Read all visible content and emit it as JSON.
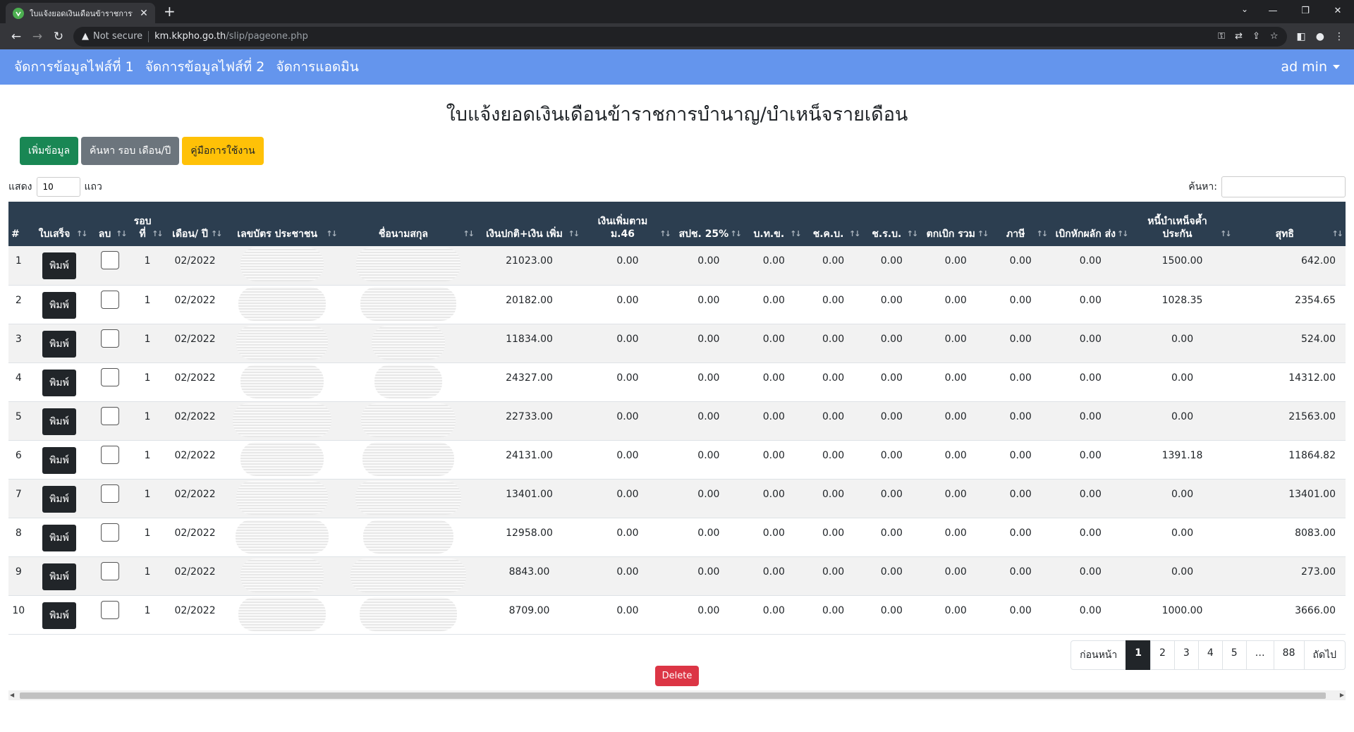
{
  "browser": {
    "tab_title": "ใบแจ้งยอดเงินเดือนข้าราชการบำนาญ/",
    "tab_close": "✕",
    "new_tab": "+",
    "tab_menu": "⌄",
    "win_min": "—",
    "win_restore": "❐",
    "win_close": "✕",
    "security_label": "Not secure",
    "url_host": "km.kkpho.go.th",
    "url_path": "/slip/pageone.php"
  },
  "nav": {
    "items": [
      "จัดการข้อมูลไฟส์ที่ 1",
      "จัดการข้อมูลไฟส์ที่ 2",
      "จัดการแอดมิน"
    ],
    "user": "ad min"
  },
  "page": {
    "title": "ใบแจ้งยอดเงินเดือนข้าราชการบำนาญ/บำเหน็จรายเดือน",
    "add_button": "เพิ่มข้อมูล",
    "search_period_button": "ค้นหา รอบ เดือน/ปี",
    "manual_button": "คู่มือการใช้งาน",
    "show_label": "แสดง",
    "page_length": "10",
    "rows_label": "แถว",
    "search_label": "ค้นหา:",
    "delete_button": "Delete"
  },
  "table": {
    "columns": [
      "#",
      "ใบเสร็จ",
      "ลบ",
      "รอบ ที่",
      "เดือน/ ปี",
      "เลขบัตร ประชาชน",
      "ชื่อนามสกุล",
      "เงินปกติ+เงิน เพิ่ม",
      "เงินเพิ่มตาม ม.46",
      "สปช. 25%",
      "บ.ท.ข.",
      "ช.ค.บ.",
      "ช.ร.บ.",
      "ตกเบิก รวม",
      "ภาษี",
      "เบิกหักผลัก ส่ง",
      "หนี้บำเหน็จค้ำ ประกัน",
      "สุทธิ"
    ],
    "print_label": "พิมพ์",
    "rows": [
      {
        "no": "1",
        "round": "1",
        "period": "02/2022",
        "base": "21023.00",
        "m46": "0.00",
        "spc": "0.00",
        "btk": "0.00",
        "ckb": "0.00",
        "crb": "0.00",
        "arrears": "0.00",
        "tax": "0.00",
        "deduct": "0.00",
        "debt": "1500.00",
        "net": "642.00"
      },
      {
        "no": "2",
        "round": "1",
        "period": "02/2022",
        "base": "20182.00",
        "m46": "0.00",
        "spc": "0.00",
        "btk": "0.00",
        "ckb": "0.00",
        "crb": "0.00",
        "arrears": "0.00",
        "tax": "0.00",
        "deduct": "0.00",
        "debt": "1028.35",
        "net": "2354.65"
      },
      {
        "no": "3",
        "round": "1",
        "period": "02/2022",
        "base": "11834.00",
        "m46": "0.00",
        "spc": "0.00",
        "btk": "0.00",
        "ckb": "0.00",
        "crb": "0.00",
        "arrears": "0.00",
        "tax": "0.00",
        "deduct": "0.00",
        "debt": "0.00",
        "net": "524.00"
      },
      {
        "no": "4",
        "round": "1",
        "period": "02/2022",
        "base": "24327.00",
        "m46": "0.00",
        "spc": "0.00",
        "btk": "0.00",
        "ckb": "0.00",
        "crb": "0.00",
        "arrears": "0.00",
        "tax": "0.00",
        "deduct": "0.00",
        "debt": "0.00",
        "net": "14312.00"
      },
      {
        "no": "5",
        "round": "1",
        "period": "02/2022",
        "base": "22733.00",
        "m46": "0.00",
        "spc": "0.00",
        "btk": "0.00",
        "ckb": "0.00",
        "crb": "0.00",
        "arrears": "0.00",
        "tax": "0.00",
        "deduct": "0.00",
        "debt": "0.00",
        "net": "21563.00"
      },
      {
        "no": "6",
        "round": "1",
        "period": "02/2022",
        "base": "24131.00",
        "m46": "0.00",
        "spc": "0.00",
        "btk": "0.00",
        "ckb": "0.00",
        "crb": "0.00",
        "arrears": "0.00",
        "tax": "0.00",
        "deduct": "0.00",
        "debt": "1391.18",
        "net": "11864.82"
      },
      {
        "no": "7",
        "round": "1",
        "period": "02/2022",
        "base": "13401.00",
        "m46": "0.00",
        "spc": "0.00",
        "btk": "0.00",
        "ckb": "0.00",
        "crb": "0.00",
        "arrears": "0.00",
        "tax": "0.00",
        "deduct": "0.00",
        "debt": "0.00",
        "net": "13401.00"
      },
      {
        "no": "8",
        "round": "1",
        "period": "02/2022",
        "base": "12958.00",
        "m46": "0.00",
        "spc": "0.00",
        "btk": "0.00",
        "ckb": "0.00",
        "crb": "0.00",
        "arrears": "0.00",
        "tax": "0.00",
        "deduct": "0.00",
        "debt": "0.00",
        "net": "8083.00"
      },
      {
        "no": "9",
        "round": "1",
        "period": "02/2022",
        "base": "8843.00",
        "m46": "0.00",
        "spc": "0.00",
        "btk": "0.00",
        "ckb": "0.00",
        "crb": "0.00",
        "arrears": "0.00",
        "tax": "0.00",
        "deduct": "0.00",
        "debt": "0.00",
        "net": "273.00"
      },
      {
        "no": "10",
        "round": "1",
        "period": "02/2022",
        "base": "8709.00",
        "m46": "0.00",
        "spc": "0.00",
        "btk": "0.00",
        "ckb": "0.00",
        "crb": "0.00",
        "arrears": "0.00",
        "tax": "0.00",
        "deduct": "0.00",
        "debt": "1000.00",
        "net": "3666.00"
      }
    ]
  },
  "pagination": {
    "prev": "ก่อนหน้า",
    "pages": [
      "1",
      "2",
      "3",
      "4",
      "5",
      "…",
      "88"
    ],
    "active": "1",
    "next": "ถัดไป"
  },
  "colors": {
    "navbar": "#6495ed",
    "table_header": "#2c3e50",
    "add": "#198754",
    "search": "#6c757d",
    "manual": "#ffc107",
    "delete": "#dc3545"
  }
}
